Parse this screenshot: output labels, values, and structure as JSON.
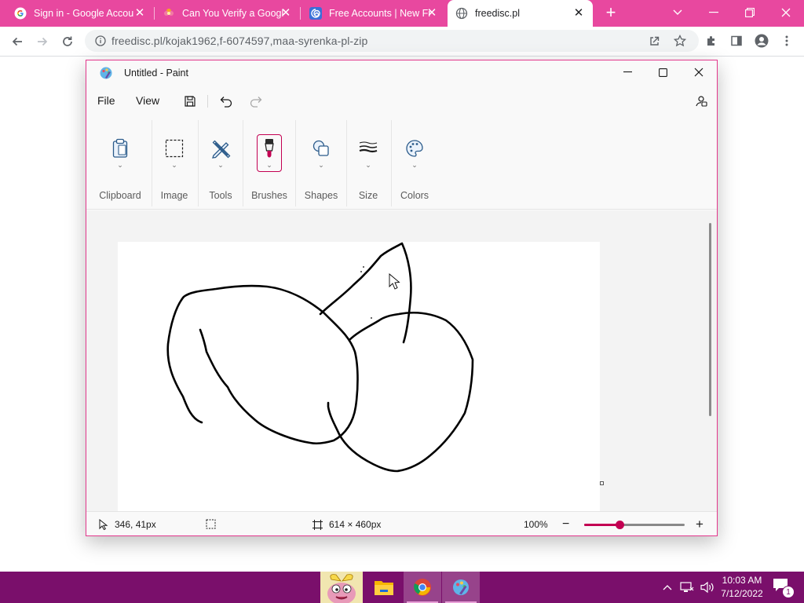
{
  "browser": {
    "tabs": [
      {
        "title": "Sign in - Google Accou",
        "icon": "google-icon"
      },
      {
        "title": "Can You Verify a Googl",
        "icon": "flower-icon"
      },
      {
        "title": "Free Accounts | New Fr",
        "icon": "spiral-icon"
      },
      {
        "title": "freedisc.pl",
        "icon": "globe-icon",
        "active": true
      }
    ],
    "url": "freedisc.pl/kojak1962,f-6074597,maa-syrenka-pl-zip",
    "accent_color": "#e8489f"
  },
  "paint": {
    "window_title": "Untitled - Paint",
    "menu": {
      "file": "File",
      "view": "View"
    },
    "ribbon": {
      "clipboard": "Clipboard",
      "image": "Image",
      "tools": "Tools",
      "brushes": "Brushes",
      "shapes": "Shapes",
      "size": "Size",
      "colors": "Colors"
    },
    "status": {
      "cursor_pos": "346, 41px",
      "canvas_size": "614 × 460px",
      "zoom": "100%",
      "zoom_level": 0.35
    },
    "accent_color": "#c30052"
  },
  "taskbar": {
    "time": "10:03 AM",
    "date": "7/12/2022",
    "notification_count": "1",
    "color": "#7a0f6b"
  }
}
